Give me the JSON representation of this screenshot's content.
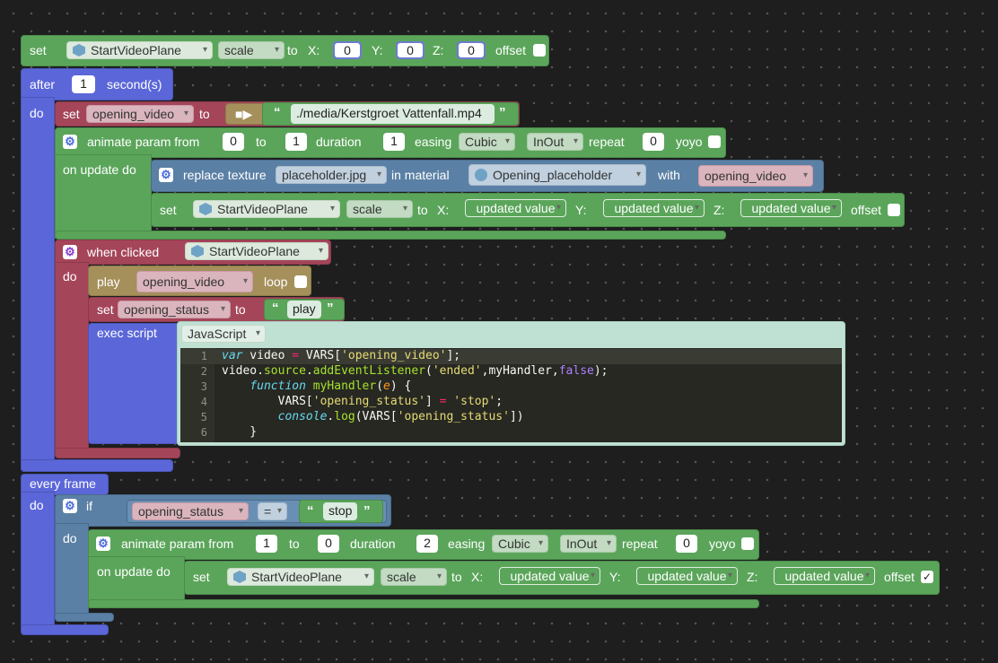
{
  "set_labels": {
    "set": "set",
    "to": "to",
    "x": "X:",
    "y": "Y:",
    "z": "Z:",
    "offset": "offset",
    "scale": "scale"
  },
  "top": {
    "object": "StartVideoPlane",
    "x": "0",
    "y": "0",
    "z": "0"
  },
  "after": {
    "label": "after",
    "value": "1",
    "unit": "second(s)",
    "do": "do"
  },
  "set_video": {
    "var": "opening_video",
    "path": "./media/Kerstgroet Vattenfall.mp4"
  },
  "animate": {
    "label": "animate param from",
    "to": "to",
    "duration": "duration",
    "easing": "easing",
    "repeat": "repeat",
    "yoyo": "yoyo",
    "on_update": "on update do",
    "curve": "Cubic",
    "mode": "InOut"
  },
  "anim1": {
    "from": "0",
    "to": "1",
    "duration": "1",
    "repeat": "0"
  },
  "replace": {
    "label": "replace texture",
    "texture": "placeholder.jpg",
    "in_material": "in material",
    "material": "Opening_placeholder",
    "with": "with",
    "var": "opening_video"
  },
  "updated": "updated value",
  "when": {
    "label": "when clicked",
    "object": "StartVideoPlane",
    "do": "do"
  },
  "play": {
    "label": "play",
    "var": "opening_video",
    "loop": "loop"
  },
  "set_status": {
    "var": "opening_status",
    "value": "play"
  },
  "exec": {
    "label": "exec script",
    "lang": "JavaScript"
  },
  "code_lines": [
    "var video = VARS['opening_video'];",
    "video.source.addEventListener('ended',myHandler,false);",
    "function myHandler(e) {",
    "VARS['opening_status'] = 'stop';",
    "console.log(VARS['opening_status'])",
    "}"
  ],
  "every": {
    "label": "every frame",
    "do": "do"
  },
  "if": {
    "label": "if",
    "do": "do",
    "var": "opening_status",
    "op": "=",
    "value": "stop"
  },
  "anim2": {
    "from": "1",
    "to": "0",
    "duration": "2",
    "repeat": "0"
  },
  "colors": {
    "green": "#5ba55b",
    "purple": "#5b67d8",
    "red": "#a5455a",
    "olive": "#a5905b",
    "blue": "#5b80a5"
  }
}
